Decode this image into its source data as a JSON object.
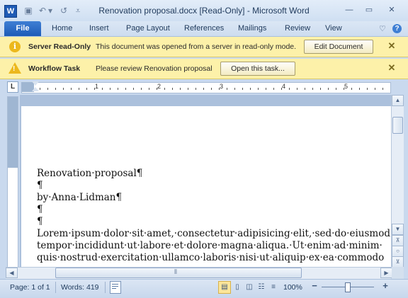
{
  "app": {
    "title": "Renovation proposal.docx [Read-Only]  -  Microsoft Word",
    "icon_letter": "W"
  },
  "qat": [
    {
      "name": "save-icon",
      "glyph": "▣"
    },
    {
      "name": "undo-icon",
      "glyph": "↶"
    },
    {
      "name": "dropdown-icon",
      "glyph": "▾"
    },
    {
      "name": "redo-icon",
      "glyph": "↺"
    },
    {
      "name": "customize-qat-icon",
      "glyph": "⩡"
    }
  ],
  "window_controls": {
    "minimize": "—",
    "restore": "▭",
    "close": "✕"
  },
  "ribbon": {
    "file_label": "File",
    "tabs": [
      "Home",
      "Insert",
      "Page Layout",
      "References",
      "Mailings",
      "Review",
      "View"
    ],
    "minimize_glyph": "♡",
    "help_glyph": "?"
  },
  "message_bars": [
    {
      "icon": "info-icon",
      "icon_glyph": "i",
      "title": "Server Read-Only",
      "text": "This document was opened from a server in read-only mode.",
      "button": "Edit Document",
      "close": "✕"
    },
    {
      "icon": "warning-icon",
      "icon_glyph": "!",
      "title": "Workflow Task",
      "text": "Please review Renovation proposal",
      "button": "Open this task...",
      "close": "✕"
    }
  ],
  "ruler": {
    "corner_glyph": "L",
    "numbers": [
      "1",
      "2",
      "3",
      "4",
      "5"
    ]
  },
  "document": {
    "lines": [
      "Renovation·proposal¶",
      "¶",
      "by·Anna·Lidman¶",
      "¶",
      "¶",
      "Lorem·ipsum·dolor·sit·amet,·consectetur·adipisicing·elit,·sed·do·eiusmod·",
      "tempor·incididunt·ut·labore·et·dolore·magna·aliqua.·Ut·enim·ad·minim·",
      "quis·nostrud·exercitation·ullamco·laboris·nisi·ut·aliquip·ex·ea·commodo"
    ]
  },
  "scrollbar": {
    "up": "▲",
    "down": "▼",
    "prev_page": "⊼",
    "browse": "○",
    "next_page": "⊻",
    "left": "◀",
    "right": "▶",
    "grip": "⦀"
  },
  "status": {
    "page": "Page: 1 of 1",
    "words": "Words: 419",
    "proofing_icon": "proofing-icon",
    "views": [
      {
        "name": "print-layout-view",
        "glyph": "▤",
        "active": true
      },
      {
        "name": "full-screen-reading-view",
        "glyph": "▯",
        "active": false
      },
      {
        "name": "web-layout-view",
        "glyph": "◫",
        "active": false
      },
      {
        "name": "outline-view",
        "glyph": "☷",
        "active": false
      },
      {
        "name": "draft-view",
        "glyph": "≡",
        "active": false
      }
    ],
    "zoom": "100%",
    "zoom_out": "−",
    "zoom_in": "+"
  },
  "colors": {
    "file_tab": "#1d5bb7",
    "message_bar": "#fdf1a9",
    "frame": "#c9d9ee"
  }
}
